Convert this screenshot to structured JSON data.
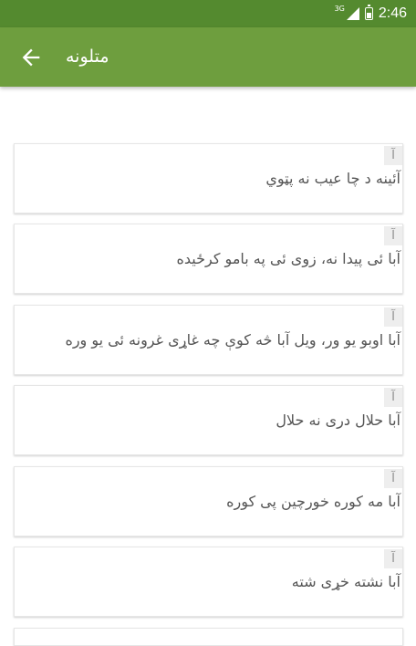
{
  "status_bar": {
    "network": "3G",
    "time": "2:46"
  },
  "app_bar": {
    "title": "متلونه",
    "back_icon": "arrow-back-icon"
  },
  "items": [
    {
      "badge": "آ",
      "text": "آئینه د چا عیب نه پټوي"
    },
    {
      "badge": "آ",
      "text": "آبا ئی پیدا نه، زوی ئی په بامو کرځیده"
    },
    {
      "badge": "آ",
      "text": "آبا اوبو یو ور، ویل آبا څه کوې چه غاړی غرونه ئی یو وره"
    },
    {
      "badge": "آ",
      "text": "آبا حلال دری نه حلال"
    },
    {
      "badge": "آ",
      "text": "آبا مه کوره خورچین پی کوره"
    },
    {
      "badge": "آ",
      "text": "آبا نشته خړی شته"
    }
  ]
}
